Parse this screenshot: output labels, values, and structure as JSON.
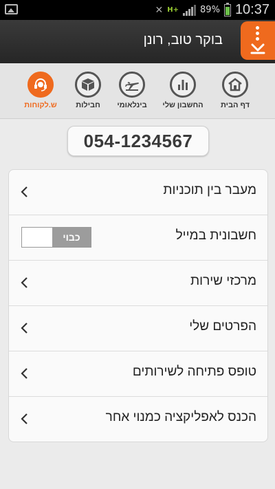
{
  "status_bar": {
    "network": "H+",
    "battery_percent": "89%",
    "time": "10:37"
  },
  "header": {
    "greeting": "בוקר טוב, רונן",
    "accent": "#ef6a1e"
  },
  "nav": [
    {
      "label": "ש.לקוחות",
      "icon": "headset-icon",
      "active": true
    },
    {
      "label": "חבילות",
      "icon": "box-icon",
      "active": false
    },
    {
      "label": "בינלאומי",
      "icon": "airplane-icon",
      "active": false
    },
    {
      "label": "החשבון שלי",
      "icon": "bar-chart-icon",
      "active": false
    },
    {
      "label": "דף הבית",
      "icon": "home-icon",
      "active": false
    }
  ],
  "phone_number": "054-1234567",
  "menu_items": [
    {
      "label": "מעבר בין תוכניות"
    },
    {
      "label": "חשבונית במייל",
      "toggle_label": "כבוי",
      "toggle_state": "off"
    },
    {
      "label": "מרכזי שירות"
    },
    {
      "label": "הפרטים שלי"
    },
    {
      "label": "טופס פתיחה לשירותים"
    },
    {
      "label": "הכנס לאפליקציה כמנוי אחר"
    }
  ]
}
